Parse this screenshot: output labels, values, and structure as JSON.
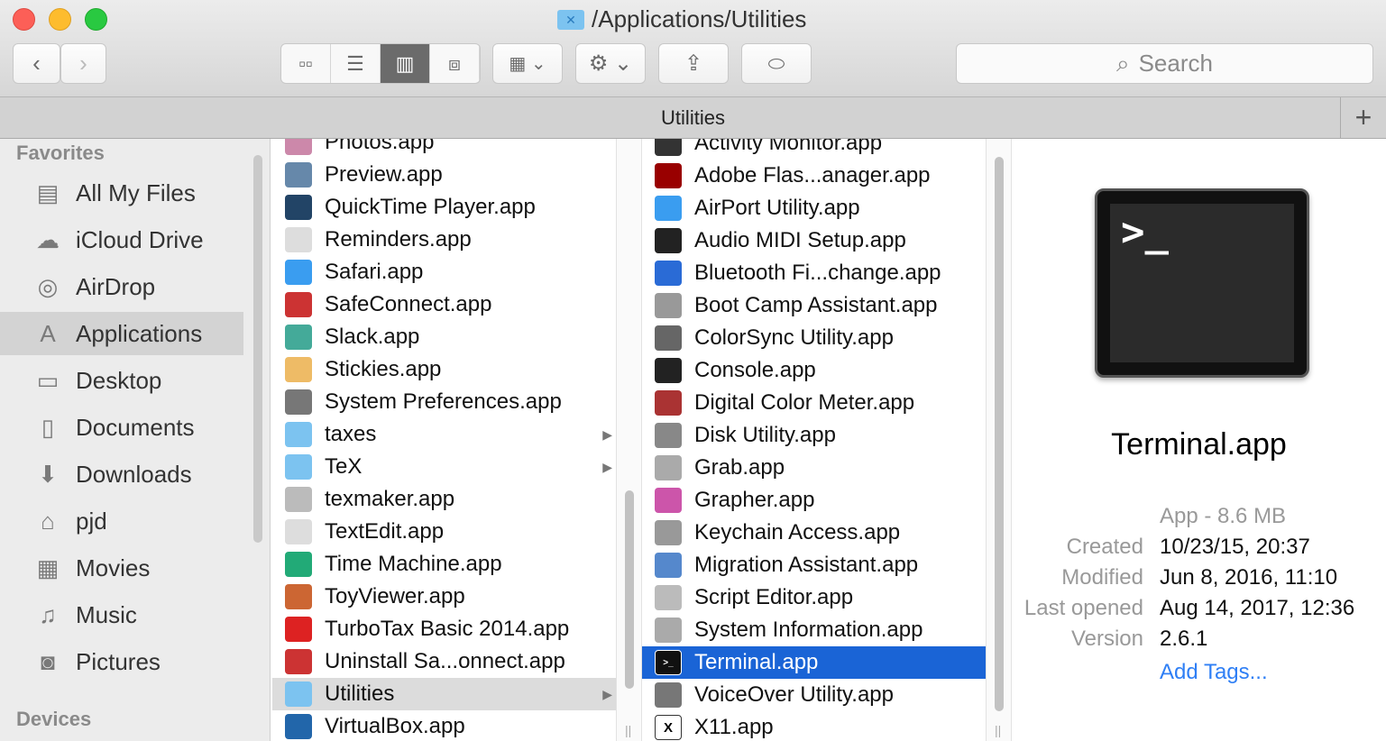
{
  "window": {
    "title": "/Applications/Utilities",
    "path_bar": "Utilities",
    "search_placeholder": "Search",
    "colors": {
      "selection": "#1a64d6",
      "link": "#2f7ff5"
    }
  },
  "toolbar": {
    "back": "‹",
    "forward": "›",
    "views": [
      "icon-view",
      "list-view",
      "column-view",
      "cover-flow-view"
    ],
    "active_view": "column-view"
  },
  "sidebar": {
    "favorites_label": "Favorites",
    "devices_label": "Devices",
    "items": [
      {
        "label": "All My Files",
        "icon": "▤"
      },
      {
        "label": "iCloud Drive",
        "icon": "☁"
      },
      {
        "label": "AirDrop",
        "icon": "◎"
      },
      {
        "label": "Applications",
        "icon": "A"
      },
      {
        "label": "Desktop",
        "icon": "▭"
      },
      {
        "label": "Documents",
        "icon": "▯"
      },
      {
        "label": "Downloads",
        "icon": "⬇"
      },
      {
        "label": "pjd",
        "icon": "⌂"
      },
      {
        "label": "Movies",
        "icon": "▦"
      },
      {
        "label": "Music",
        "icon": "♫"
      },
      {
        "label": "Pictures",
        "icon": "◙"
      }
    ],
    "selected": "Applications"
  },
  "column1": [
    {
      "name": "Photos.app",
      "color": "#c8a"
    },
    {
      "name": "Preview.app",
      "color": "#68a"
    },
    {
      "name": "QuickTime Player.app",
      "color": "#246"
    },
    {
      "name": "Reminders.app",
      "color": "#ddd"
    },
    {
      "name": "Safari.app",
      "color": "#3a9df0"
    },
    {
      "name": "SafeConnect.app",
      "color": "#c33"
    },
    {
      "name": "Slack.app",
      "color": "#4a9"
    },
    {
      "name": "Stickies.app",
      "color": "#eb6"
    },
    {
      "name": "System Preferences.app",
      "color": "#777"
    },
    {
      "name": "taxes",
      "color": "#7cc3f0",
      "folder": true
    },
    {
      "name": "TeX",
      "color": "#7cc3f0",
      "folder": true
    },
    {
      "name": "texmaker.app",
      "color": "#bbb"
    },
    {
      "name": "TextEdit.app",
      "color": "#ddd"
    },
    {
      "name": "Time Machine.app",
      "color": "#2a7"
    },
    {
      "name": "ToyViewer.app",
      "color": "#c63"
    },
    {
      "name": "TurboTax Basic 2014.app",
      "color": "#d22"
    },
    {
      "name": "Uninstall Sa...onnect.app",
      "color": "#c33"
    },
    {
      "name": "Utilities",
      "color": "#7cc3f0",
      "folder": true,
      "highlight": true
    },
    {
      "name": "VirtualBox.app",
      "color": "#26a"
    }
  ],
  "column2": [
    {
      "name": "Activity Monitor.app",
      "color": "#333"
    },
    {
      "name": "Adobe Flas...anager.app",
      "color": "#900"
    },
    {
      "name": "AirPort Utility.app",
      "color": "#3a9df0"
    },
    {
      "name": "Audio MIDI Setup.app",
      "color": "#222"
    },
    {
      "name": "Bluetooth Fi...change.app",
      "color": "#2a6bd6"
    },
    {
      "name": "Boot Camp Assistant.app",
      "color": "#999"
    },
    {
      "name": "ColorSync Utility.app",
      "color": "#666"
    },
    {
      "name": "Console.app",
      "color": "#222"
    },
    {
      "name": "Digital Color Meter.app",
      "color": "#a33"
    },
    {
      "name": "Disk Utility.app",
      "color": "#888"
    },
    {
      "name": "Grab.app",
      "color": "#aaa"
    },
    {
      "name": "Grapher.app",
      "color": "#c5a"
    },
    {
      "name": "Keychain Access.app",
      "color": "#999"
    },
    {
      "name": "Migration Assistant.app",
      "color": "#58c"
    },
    {
      "name": "Script Editor.app",
      "color": "#bbb"
    },
    {
      "name": "System Information.app",
      "color": "#aaa"
    },
    {
      "name": "Terminal.app",
      "color": "#111",
      "selected": true
    },
    {
      "name": "VoiceOver Utility.app",
      "color": "#777"
    },
    {
      "name": "X11.app",
      "color": "#fff"
    }
  ],
  "preview": {
    "name": "Terminal.app",
    "prompt": ">_",
    "kind": "App - 8.6 MB",
    "fields": [
      {
        "label": "Created",
        "value": "10/23/15, 20:37"
      },
      {
        "label": "Modified",
        "value": "Jun 8, 2016, 11:10"
      },
      {
        "label": "Last opened",
        "value": "Aug 14, 2017, 12:36"
      },
      {
        "label": "Version",
        "value": "2.6.1"
      }
    ],
    "add_tags": "Add Tags..."
  }
}
